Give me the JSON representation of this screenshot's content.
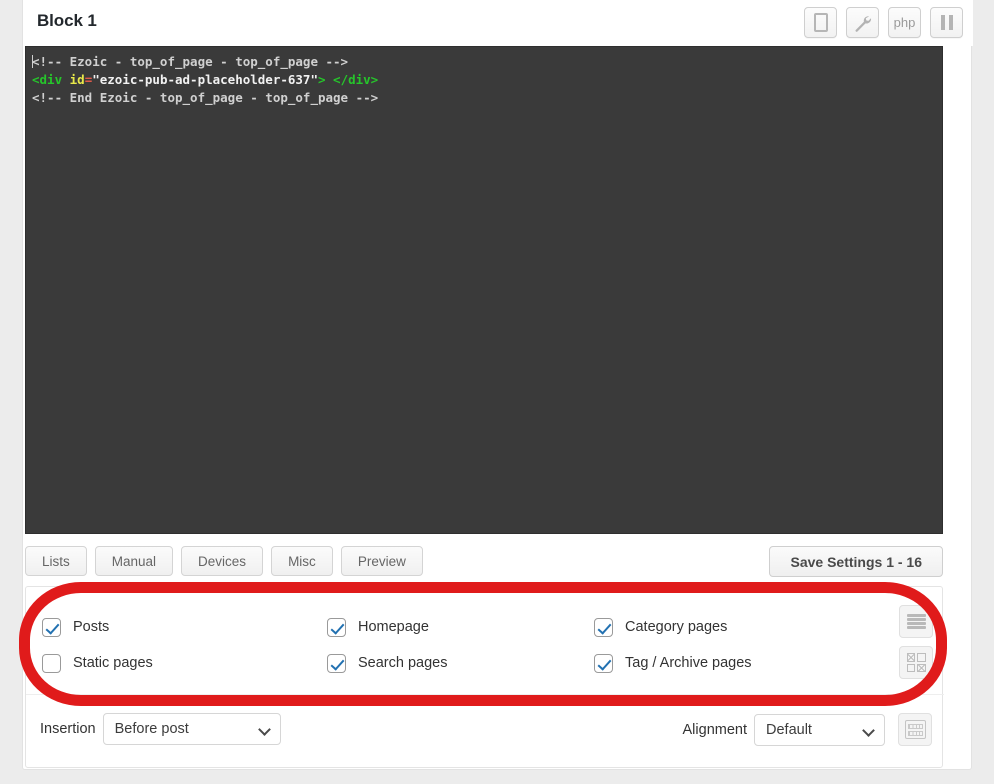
{
  "header": {
    "title": "Block 1",
    "tools": [
      {
        "name": "device-icon",
        "label": "Device"
      },
      {
        "name": "wrench-icon",
        "label": "Settings"
      },
      {
        "name": "php-icon",
        "label": "php"
      },
      {
        "name": "pause-icon",
        "label": "Pause"
      }
    ],
    "php_label": "php"
  },
  "editor": {
    "line1": "<!-- Ezoic - top_of_page - top_of_page -->",
    "line2_tag_open": "<div",
    "line2_attr": " id",
    "line2_eq": "=",
    "line2_value": "\"ezoic-pub-ad-placeholder-637\"",
    "line2_tag_close": "> </div>",
    "line3": "<!-- End Ezoic - top_of_page - top_of_page -->"
  },
  "tabs": [
    {
      "label": "Lists"
    },
    {
      "label": "Manual"
    },
    {
      "label": "Devices"
    },
    {
      "label": "Misc"
    },
    {
      "label": "Preview"
    }
  ],
  "save": {
    "label": "Save Settings 1 - 16"
  },
  "display_options": {
    "columns": [
      {
        "items": [
          {
            "label": "Posts",
            "checked": true
          },
          {
            "label": "Static pages",
            "checked": false
          }
        ]
      },
      {
        "items": [
          {
            "label": "Homepage",
            "checked": true
          },
          {
            "label": "Search pages",
            "checked": true
          }
        ]
      },
      {
        "items": [
          {
            "label": "Category pages",
            "checked": true
          },
          {
            "label": "Tag / Archive pages",
            "checked": true
          }
        ]
      }
    ],
    "side_icons": [
      {
        "name": "list-view-icon"
      },
      {
        "name": "grid-view-icon"
      }
    ]
  },
  "bottom": {
    "insertion_label": "Insertion",
    "insertion_value": "Before post",
    "alignment_label": "Alignment",
    "alignment_value": "Default",
    "keyboard_icon": "keyboard-icon"
  },
  "annotation": {
    "color": "#e01b1b",
    "shape": "rounded-rect-highlight"
  }
}
